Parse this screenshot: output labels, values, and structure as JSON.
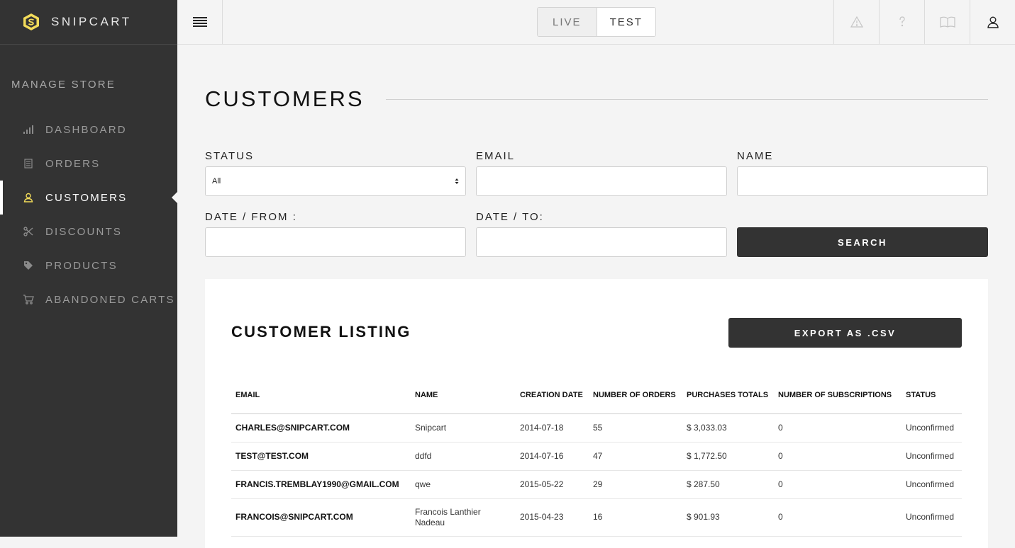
{
  "brand": {
    "name": "SNIPCART",
    "logo_color": "#f3dc5a"
  },
  "sidebar": {
    "section_title": "MANAGE STORE",
    "items": [
      {
        "label": "DASHBOARD",
        "icon": "bar-chart-icon"
      },
      {
        "label": "ORDERS",
        "icon": "receipt-icon"
      },
      {
        "label": "CUSTOMERS",
        "icon": "user-icon",
        "active": true
      },
      {
        "label": "DISCOUNTS",
        "icon": "scissors-icon"
      },
      {
        "label": "PRODUCTS",
        "icon": "tag-icon"
      },
      {
        "label": "ABANDONED CARTS",
        "icon": "cart-icon"
      }
    ]
  },
  "topbar": {
    "env": {
      "live": "LIVE",
      "test": "TEST",
      "selected": "TEST"
    },
    "icons": [
      "warning-icon",
      "help-icon",
      "book-icon",
      "account-icon"
    ]
  },
  "page": {
    "title": "CUSTOMERS"
  },
  "filters": {
    "status_label": "STATUS",
    "status_value": "All",
    "email_label": "EMAIL",
    "email_value": "",
    "name_label": "NAME",
    "name_value": "",
    "date_from_label": "DATE / FROM :",
    "date_from_value": "",
    "date_to_label": "DATE / TO:",
    "date_to_value": "",
    "search_label": "SEARCH"
  },
  "listing": {
    "title": "CUSTOMER LISTING",
    "export_label": "EXPORT AS .CSV",
    "columns": [
      "EMAIL",
      "NAME",
      "CREATION DATE",
      "NUMBER OF ORDERS",
      "PURCHASES TOTALS",
      "NUMBER OF SUBSCRIPTIONS",
      "STATUS"
    ],
    "rows": [
      {
        "email": "CHARLES@SNIPCART.COM",
        "name": "Snipcart",
        "date": "2014-07-18",
        "orders": "55",
        "total": "$ 3,033.03",
        "subs": "0",
        "status": "Unconfirmed"
      },
      {
        "email": "TEST@TEST.COM",
        "name": "ddfd",
        "date": "2014-07-16",
        "orders": "47",
        "total": "$ 1,772.50",
        "subs": "0",
        "status": "Unconfirmed"
      },
      {
        "email": "FRANCIS.TREMBLAY1990@GMAIL.COM",
        "name": "qwe",
        "date": "2015-05-22",
        "orders": "29",
        "total": "$ 287.50",
        "subs": "0",
        "status": "Unconfirmed"
      },
      {
        "email": "FRANCOIS@SNIPCART.COM",
        "name": "Francois Lanthier Nadeau",
        "date": "2015-04-23",
        "orders": "16",
        "total": "$ 901.93",
        "subs": "0",
        "status": "Unconfirmed"
      }
    ]
  }
}
